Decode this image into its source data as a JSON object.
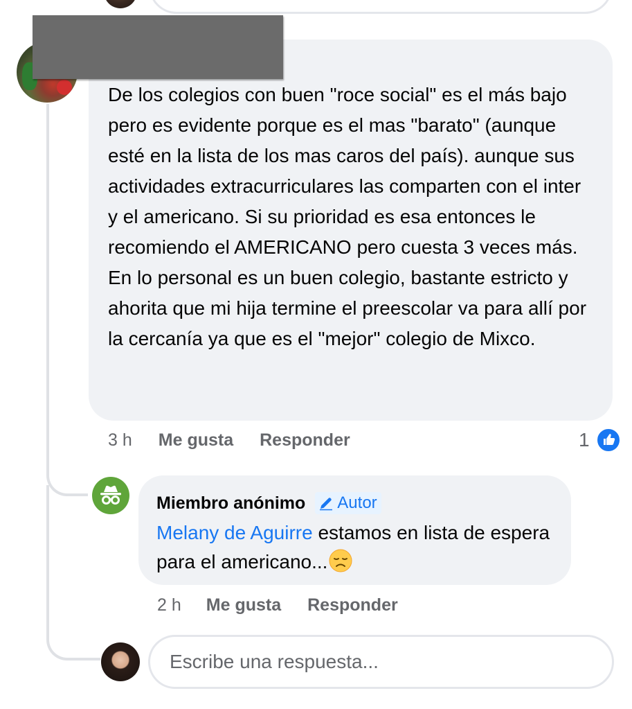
{
  "main_comment": {
    "author_redacted": true,
    "text": "De los colegios con buen \"roce social\" es el más bajo pero es evidente porque es el mas \"barato\" (aunque esté en la lista de los mas caros del país). aunque sus actividades extracurriculares las comparten con el inter y el americano. Si su prioridad es esa entonces le recomiendo el AMERICANO pero cuesta 3 veces más. En lo personal es un buen colegio, bastante estricto y ahorita que mi hija termine el preescolar va para allí por la cercanía ya que es el \"mejor\" colegio de Mixco.",
    "time": "3 h",
    "like_label": "Me gusta",
    "reply_label": "Responder",
    "reaction_count": "1",
    "reaction_icon": "like-thumb-icon"
  },
  "reply": {
    "author": "Miembro anónimo",
    "badge_label": "Autor",
    "badge_icon": "pencil-icon",
    "mention": "Melany de Aguirre",
    "text": " estamos en lista de espera para el americano...",
    "emoji": "disappointed-face-icon",
    "time": "2 h",
    "like_label": "Me gusta",
    "reply_label": "Responder"
  },
  "reply_input": {
    "placeholder": "Escribe una respuesta..."
  },
  "colors": {
    "bubble": "#f0f2f5",
    "secondary_text": "#65676b",
    "link_blue": "#1877f2",
    "anon_green": "#5fa53a",
    "thread_line": "#dfe1e5"
  }
}
